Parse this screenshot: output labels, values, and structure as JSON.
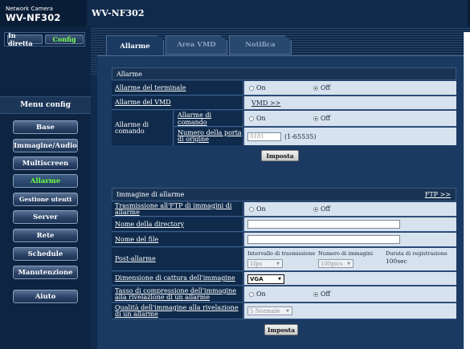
{
  "brand": {
    "small": "Network Camera",
    "model": "WV-NF302"
  },
  "header": {
    "title": "WV-NF302"
  },
  "modes": {
    "live": "In diretta",
    "config": "Config"
  },
  "menu": {
    "heading": "Menu config",
    "items": [
      "Base",
      "Immagine/Audio",
      "Multiscreen",
      "Allarme",
      "Gestione utenti",
      "Server",
      "Rete",
      "Schedule",
      "Manutenzione",
      "Aiuto"
    ],
    "active": "Allarme"
  },
  "tabs": [
    "Allarme",
    "Area VMD",
    "Notifica"
  ],
  "alarm_section": {
    "title": "Allarme",
    "rows": {
      "terminal": {
        "label": "Allarme del terminale",
        "on": "On",
        "off": "Off",
        "selected": "Off"
      },
      "vmd": {
        "label": "Allarme del VMD",
        "link": "VMD >>"
      },
      "command": {
        "label": "Allarme di comando",
        "sub_command_label": "Allarme di comando",
        "on": "On",
        "off": "Off",
        "selected": "Off",
        "port_label": "Numero della porta di origine",
        "port_value": "8181",
        "port_range": "(1-65535)"
      }
    },
    "submit": "Imposta"
  },
  "image_section": {
    "title": "Immagine di allarme",
    "ftp_link": "FTP >>",
    "rows": {
      "ftp_transfer": {
        "label": "Trasmissione all'FTP di immagini di allarme",
        "on": "On",
        "off": "Off",
        "selected": "Off"
      },
      "directory": {
        "label": "Nome della directory",
        "value": ""
      },
      "filename": {
        "label": "Nome del file",
        "value": ""
      },
      "post_alarm": {
        "label": "Post-allarme",
        "interval_label": "Intervallo di trasmissione",
        "interval_value": "1fps",
        "count_label": "Numero di immagini",
        "count_value": "100pics",
        "duration_label": "Durata di registrazione",
        "duration_value": "100sec"
      },
      "capture_size": {
        "label": "Dimensione di cattura dell'immagine",
        "value": "VGA"
      },
      "compression": {
        "label": "Tasso di compressione dell'immagine alla rivelazione di un allarme",
        "on": "On",
        "off": "Off",
        "selected": "Off"
      },
      "quality": {
        "label": "Qualità dell'immagine alla rivelazione di un allarme",
        "value": "5 Normale"
      }
    },
    "submit": "Imposta"
  }
}
